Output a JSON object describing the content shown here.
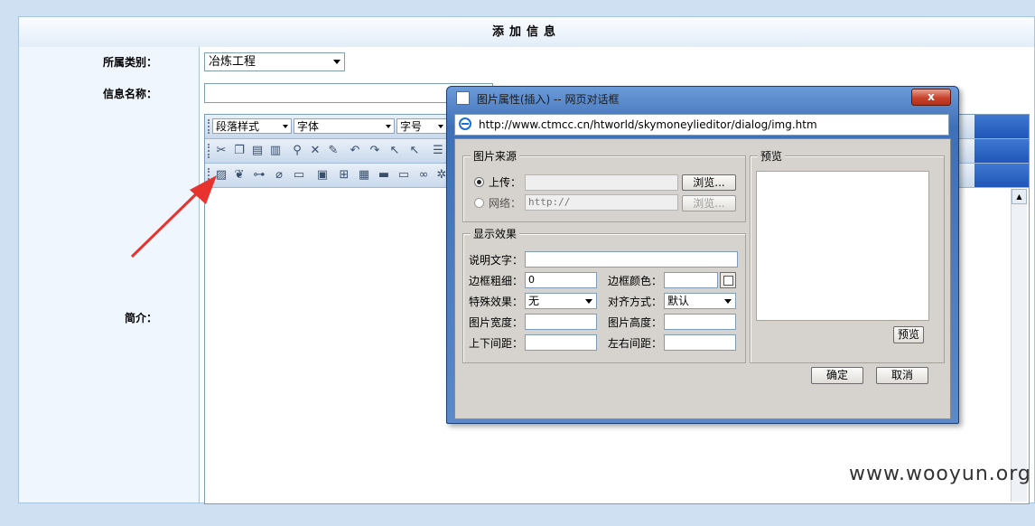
{
  "form": {
    "header": "添加信息",
    "category_label": "所属类别：",
    "category_value": "冶炼工程",
    "name_label": "信息名称：",
    "intro_label": "简介："
  },
  "editor_toolbar": {
    "paragraph_style": "段落样式",
    "font": "字体",
    "font_size": "字号"
  },
  "watermark": "www.wooyun.org",
  "dialog": {
    "title": "图片属性(插入) -- 网页对话框",
    "close": "x",
    "url": "http://www.ctmcc.cn/htworld/skymoneylieditor/dialog/img.htm",
    "source_group": {
      "legend": "图片来源",
      "upload_label": "上传：",
      "network_label": "网络：",
      "network_placeholder": "http://",
      "browse": "浏览...",
      "browse_disabled": "浏览..."
    },
    "display_group": {
      "legend": "显示效果",
      "alt_label": "说明文字：",
      "border_width_label": "边框粗细：",
      "border_width_value": "0",
      "border_color_label": "边框颜色：",
      "effect_label": "特殊效果：",
      "effect_value": "无",
      "align_label": "对齐方式：",
      "align_value": "默认",
      "width_label": "图片宽度：",
      "height_label": "图片高度：",
      "vspace_label": "上下间距：",
      "hspace_label": "左右间距："
    },
    "preview_group": {
      "legend": "预览",
      "button": "预览"
    },
    "ok": "确定",
    "cancel": "取消"
  }
}
